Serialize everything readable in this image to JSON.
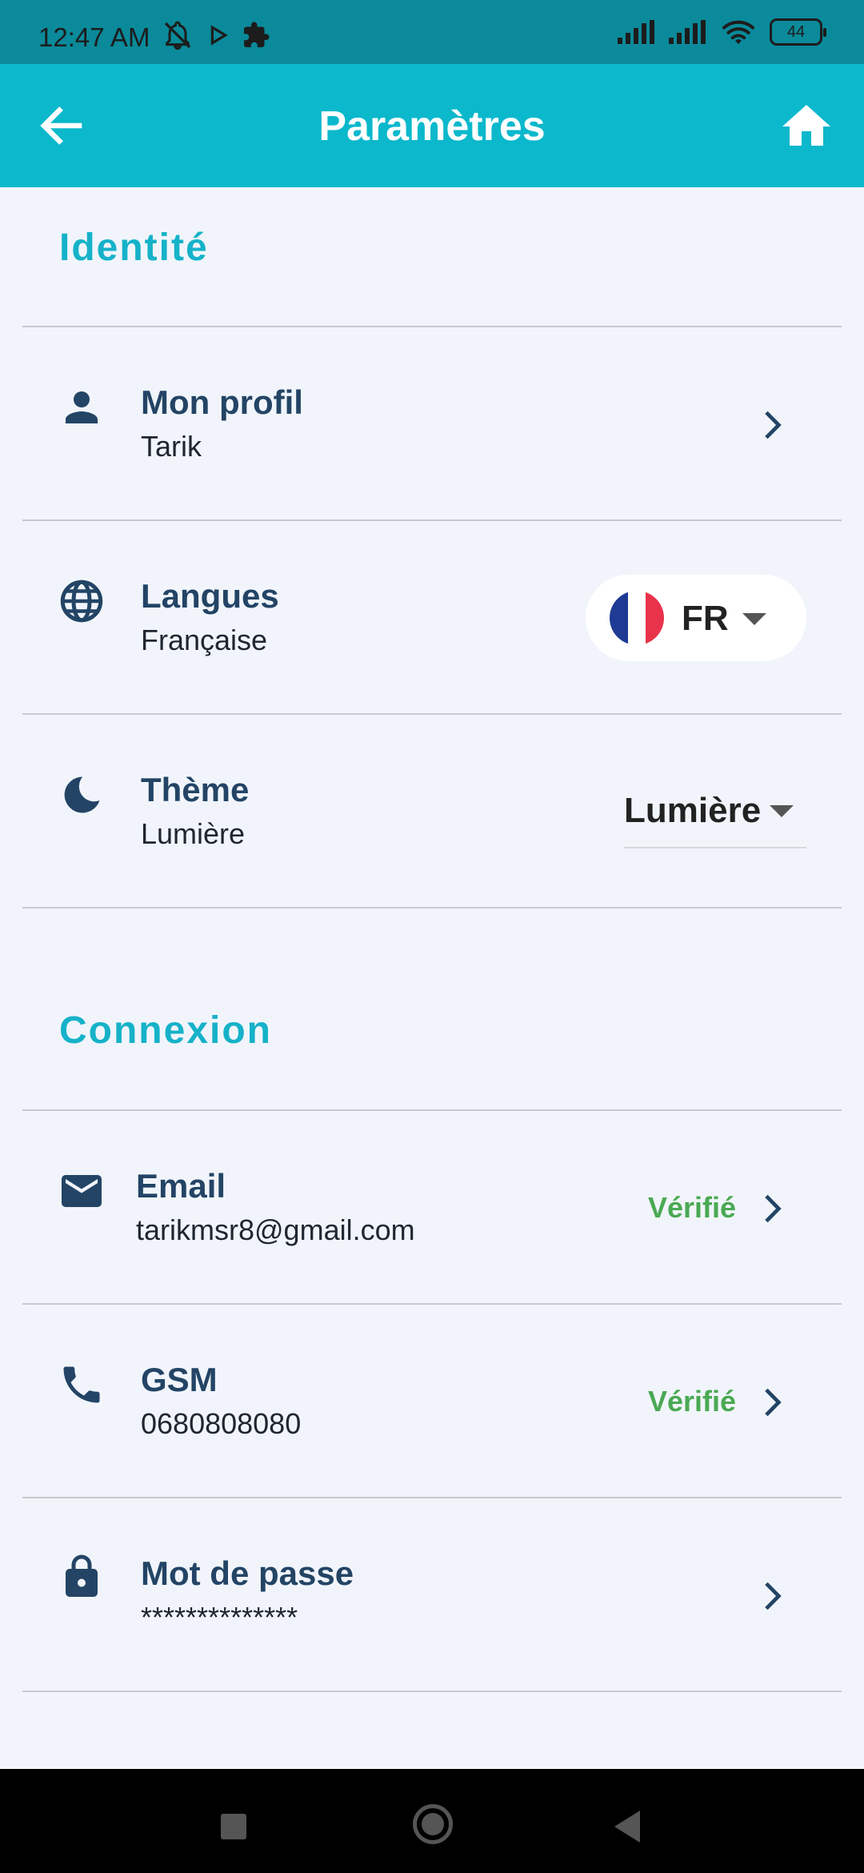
{
  "status_bar": {
    "time": "12:47 AM",
    "battery": "44",
    "left_icons": [
      "mute-icon",
      "play-icon",
      "puzzle-icon"
    ],
    "right_icons": [
      "signal-icon",
      "signal-icon",
      "wifi-icon",
      "battery-icon"
    ]
  },
  "app_bar": {
    "title": "Paramètres",
    "back_icon": "arrow-left-icon",
    "home_icon": "home-icon",
    "background_color": "#0bb8cc"
  },
  "sections": {
    "identity": {
      "title": "Identité",
      "profile": {
        "title": "Mon profil",
        "subtitle": "Tarik",
        "icon": "person-icon"
      },
      "language": {
        "title": "Langues",
        "subtitle": "Française",
        "icon": "globe-icon",
        "selected_code": "FR",
        "flag": "france-flag"
      },
      "theme": {
        "title": "Thème",
        "subtitle": "Lumière",
        "icon": "moon-icon",
        "selected_value": "Lumière"
      }
    },
    "connexion": {
      "title": "Connexion",
      "email": {
        "title": "Email",
        "subtitle": "tarikmsr8@gmail.com",
        "status": "Vérifié",
        "icon": "mail-icon"
      },
      "gsm": {
        "title": "GSM",
        "subtitle": "0680808080",
        "status": "Vérifié",
        "icon": "phone-icon"
      },
      "password": {
        "title": "Mot de passe",
        "subtitle": "**************",
        "icon": "lock-icon"
      }
    }
  },
  "colors": {
    "accent": "#16b2c9",
    "title_text": "#234465",
    "verified": "#4aa953",
    "page_background": "#f1f5fb"
  }
}
